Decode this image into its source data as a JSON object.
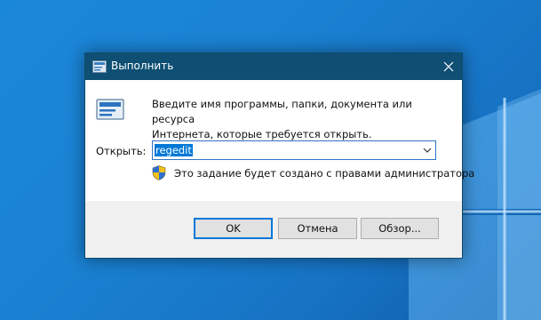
{
  "window": {
    "title": "Выполнить",
    "close_symbol": "✕"
  },
  "content": {
    "description_line1": "Введите имя программы, папки, документа или ресурса",
    "description_line2": "Интернета, которые требуется открыть.",
    "open_label": "Открыть:",
    "open_value": "regedit",
    "admin_note": "Это задание будет создано с правами администратора"
  },
  "buttons": {
    "ok": "OK",
    "cancel": "Отмена",
    "browse": "Обзор..."
  },
  "icons": {
    "title": "run-app-icon",
    "run": "run-app-icon",
    "shield": "uac-shield-icon",
    "dropdown": "chevron-down-icon",
    "close": "close-icon"
  },
  "colors": {
    "titlebar": "#0e4f73",
    "selection": "#0078d7",
    "desktop": "#1a82d3"
  }
}
